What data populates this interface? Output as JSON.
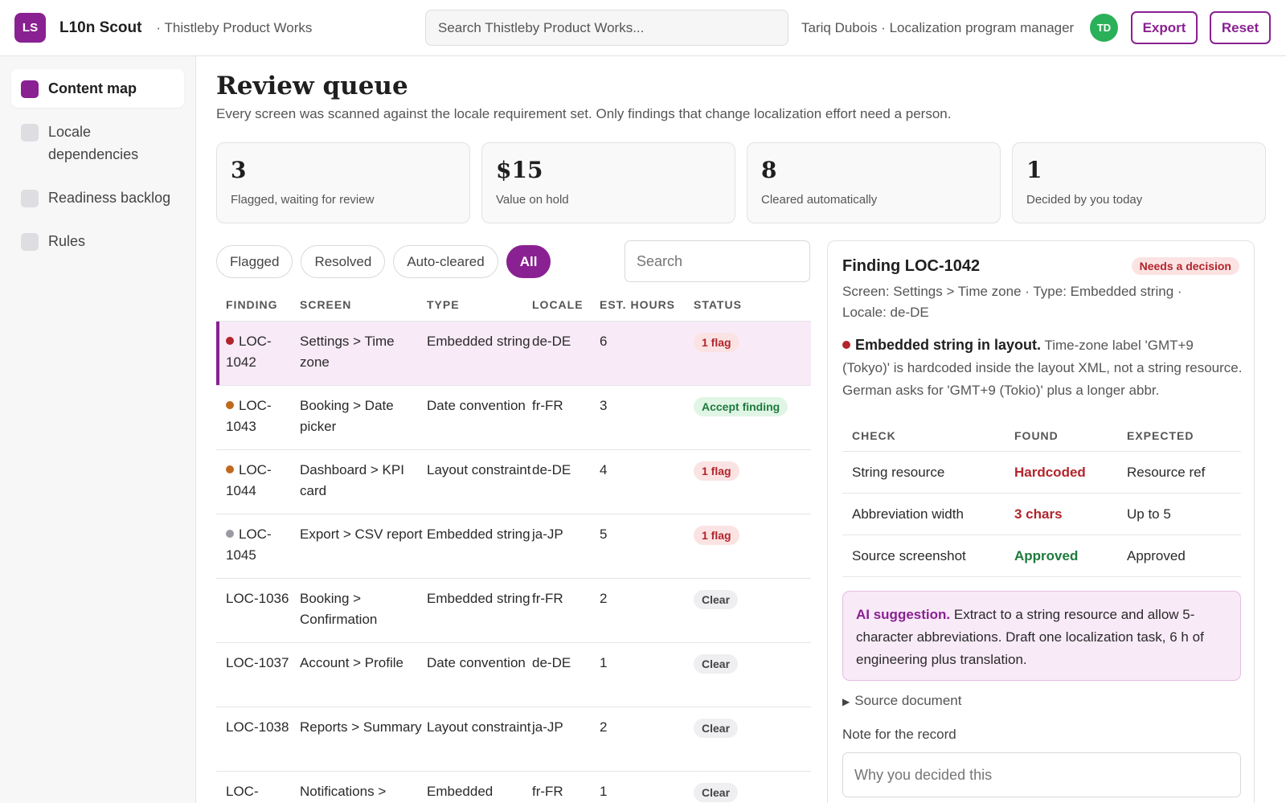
{
  "app": {
    "logo_initials": "LS",
    "name": "L10n Scout",
    "org": "· Thistleby Product Works",
    "search_placeholder": "Search Thistleby Product Works...",
    "user": "Tariq Dubois · Localization program manager",
    "avatar_initials": "TD",
    "export_label": "Export",
    "reset_label": "Reset",
    "accent_color": "#8a2192"
  },
  "sidebar": {
    "items": [
      {
        "label": "Content map",
        "active": true
      },
      {
        "label": "Locale dependencies",
        "active": false
      },
      {
        "label": "Readiness backlog",
        "active": false
      },
      {
        "label": "Rules",
        "active": false
      }
    ]
  },
  "page": {
    "title": "Review queue",
    "subtitle": "Every screen was scanned against the locale requirement set. Only findings that change localization effort need a person."
  },
  "stats": [
    {
      "value": "3",
      "label": "Flagged, waiting for review"
    },
    {
      "value": "$15",
      "label": "Value on hold"
    },
    {
      "value": "8",
      "label": "Cleared automatically"
    },
    {
      "value": "1",
      "label": "Decided by you today"
    }
  ],
  "filters": {
    "chips": [
      "Flagged",
      "Resolved",
      "Auto-cleared",
      "All"
    ],
    "active": "All",
    "search_placeholder": "Search"
  },
  "table": {
    "headers": [
      "FINDING",
      "SCREEN",
      "TYPE",
      "LOCALE",
      "EST. HOURS",
      "STATUS"
    ],
    "rows": [
      {
        "finding": "LOC-1042",
        "screen": "Settings > Time zone",
        "type": "Embedded string",
        "locale": "de-DE",
        "hours": "6",
        "status": "1 flag",
        "dot": "#b1252b"
      },
      {
        "finding": "LOC-1043",
        "screen": "Booking > Date picker",
        "type": "Date convention",
        "locale": "fr-FR",
        "hours": "3",
        "status": "Accept finding",
        "dot": "#c0691e"
      },
      {
        "finding": "LOC-1044",
        "screen": "Dashboard > KPI card",
        "type": "Layout constraint",
        "locale": "de-DE",
        "hours": "4",
        "status": "1 flag",
        "dot": "#c0691e"
      },
      {
        "finding": "LOC-1045",
        "screen": "Export > CSV report",
        "type": "Embedded string",
        "locale": "ja-JP",
        "hours": "5",
        "status": "1 flag",
        "dot": "#9a9aa3"
      },
      {
        "finding": "LOC-1036",
        "screen": "Booking > Confirmation",
        "type": "Embedded string",
        "locale": "fr-FR",
        "hours": "2",
        "status": "Clear",
        "dot": ""
      },
      {
        "finding": "LOC-1037",
        "screen": "Account > Profile",
        "type": "Date convention",
        "locale": "de-DE",
        "hours": "1",
        "status": "Clear",
        "dot": ""
      },
      {
        "finding": "LOC-1038",
        "screen": "Reports > Summary",
        "type": "Layout constraint",
        "locale": "ja-JP",
        "hours": "2",
        "status": "Clear",
        "dot": ""
      },
      {
        "finding": "LOC-",
        "screen": "Notifications >",
        "type": "Embedded",
        "locale": "fr-FR",
        "hours": "1",
        "status": "Clear",
        "dot": ""
      }
    ]
  },
  "detail": {
    "title": "Finding LOC-1042",
    "badge": "Needs a decision",
    "meta": "Screen: Settings > Time zone · Type: Embedded string · Locale: de-DE",
    "desc_title": "Embedded string in layout.",
    "desc_text": "Time-zone label 'GMT+9 (Tokyo)' is hardcoded inside the layout XML, not a string resource. German asks for 'GMT+9 (Tokio)' plus a longer abbr.",
    "check_headers": [
      "CHECK",
      "FOUND",
      "EXPECTED"
    ],
    "checks": [
      {
        "check": "String resource",
        "found": "Hardcoded",
        "expected": "Resource ref",
        "state": "bad"
      },
      {
        "check": "Abbreviation width",
        "found": "3 chars",
        "expected": "Up to 5",
        "state": "bad"
      },
      {
        "check": "Source screenshot",
        "found": "Approved",
        "expected": "Approved",
        "state": "good"
      }
    ],
    "ai_label": "AI suggestion.",
    "ai_text": "Extract to a string resource and allow 5-character abbreviations. Draft one localization task, 6 h of engineering plus translation.",
    "source_doc": "Source document",
    "note_label": "Note for the record",
    "note_placeholder": "Why you decided this"
  }
}
